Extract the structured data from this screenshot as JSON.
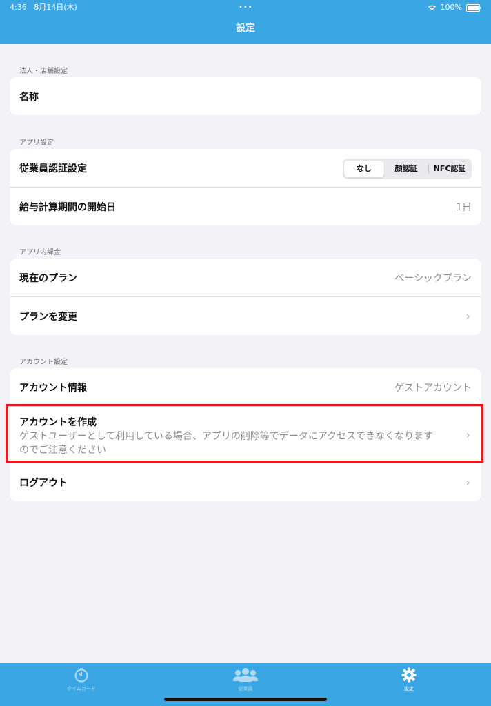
{
  "status": {
    "time": "4:36",
    "date": "8月14日(木)",
    "battery": "100%"
  },
  "nav": {
    "title": "設定"
  },
  "sections": {
    "corporate": {
      "header": "法人・店舗設定",
      "name_label": "名称"
    },
    "app": {
      "header": "アプリ設定",
      "auth_label": "従業員認証設定",
      "auth_options": [
        "なし",
        "顔認証",
        "NFC認証"
      ],
      "auth_selected": "なし",
      "payroll_label": "給与計算期間の開始日",
      "payroll_value": "1日"
    },
    "billing": {
      "header": "アプリ内課金",
      "current_plan_label": "現在のプラン",
      "current_plan_value": "ベーシックプラン",
      "change_plan_label": "プランを変更"
    },
    "account": {
      "header": "アカウント設定",
      "info_label": "アカウント情報",
      "info_value": "ゲストアカウント",
      "create_label": "アカウントを作成",
      "create_desc_line1": "ゲストユーザーとして利用している場合、アプリの削除等でデータにアクセスできなくなります",
      "create_desc_line2": "のでご注意ください",
      "logout_label": "ログアウト"
    }
  },
  "tabs": [
    {
      "label": "タイムカード",
      "icon": "timer-icon",
      "active": false
    },
    {
      "label": "従業員",
      "icon": "people-icon",
      "active": false
    },
    {
      "label": "設定",
      "icon": "gear-icon",
      "active": true
    }
  ],
  "colors": {
    "accent": "#3aa6e3",
    "highlight": "#e6191e",
    "background": "#f2f2f7"
  }
}
